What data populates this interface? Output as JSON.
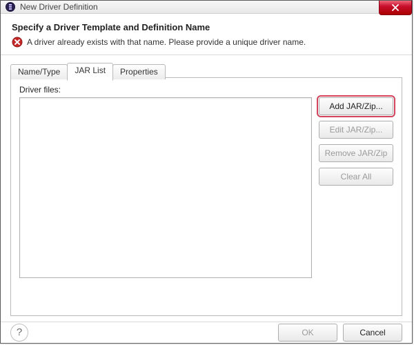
{
  "window": {
    "title": "New Driver Definition"
  },
  "header": {
    "title": "Specify a Driver Template and Definition Name",
    "message": "A driver already exists with that name. Please provide a unique driver name."
  },
  "tabs": {
    "name_type": "Name/Type",
    "jar_list": "JAR List",
    "properties": "Properties",
    "active": "jar_list"
  },
  "jar_tab": {
    "label": "Driver files:",
    "buttons": {
      "add": "Add JAR/Zip...",
      "edit": "Edit JAR/Zip...",
      "remove": "Remove JAR/Zip",
      "clear": "Clear All"
    }
  },
  "footer": {
    "ok": "OK",
    "cancel": "Cancel",
    "help_tooltip": "Help"
  }
}
